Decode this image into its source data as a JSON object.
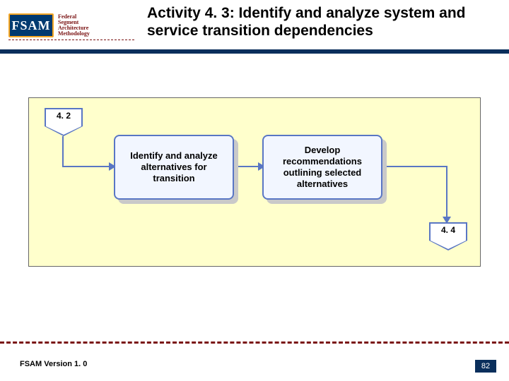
{
  "logo": {
    "badge": "FSAM",
    "line1": "Federal",
    "line2": "Segment",
    "line3": "Architecture",
    "line4": "Methodology"
  },
  "title": "Activity 4. 3:  Identify and analyze system and service transition dependencies",
  "diagram": {
    "incoming_ref": "4. 2",
    "box1": "Identify and analyze alternatives for transition",
    "box2": "Develop recommendations outlining selected alternatives",
    "outgoing_ref": "4. 4"
  },
  "footer": {
    "version": "FSAM Version 1. 0",
    "page": "82"
  }
}
